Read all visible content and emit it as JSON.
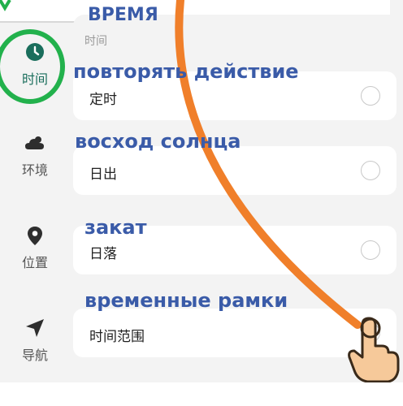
{
  "colors": {
    "accent": "#1a6e5c",
    "annotation_text": "#3a5ba8",
    "annotation_circle": "#22b14c",
    "annotation_arrow": "#f07f2a"
  },
  "sidebar": {
    "items": [
      {
        "label": "时间",
        "icon": "clock-icon",
        "active": true
      },
      {
        "label": "环境",
        "icon": "cloud-icon",
        "active": false
      },
      {
        "label": "位置",
        "icon": "location-pin-icon",
        "active": false
      },
      {
        "label": "导航",
        "icon": "navigation-arrow-icon",
        "active": false
      }
    ]
  },
  "main": {
    "section_header": "时间",
    "options": [
      {
        "label": "定时",
        "selected": false
      },
      {
        "label": "日出",
        "selected": false
      },
      {
        "label": "日落",
        "selected": false
      },
      {
        "label": "时间范围",
        "selected": false
      }
    ]
  },
  "annotations": {
    "title": "ВРЕМЯ",
    "repeat_action": "повторять действие",
    "sunrise": "восход солнца",
    "sunset": "закат",
    "time_range": "временные рамки"
  }
}
